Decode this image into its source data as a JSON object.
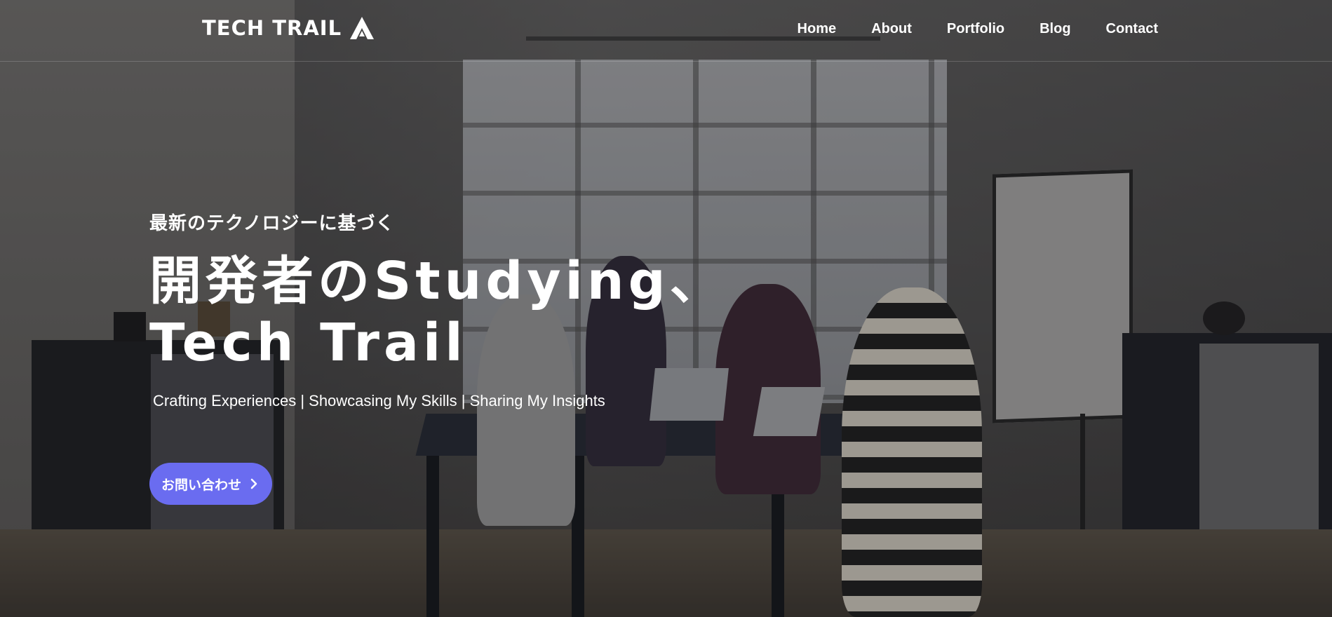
{
  "header": {
    "logo_text": "TECH TRAIL",
    "nav": [
      {
        "label": "Home"
      },
      {
        "label": "About"
      },
      {
        "label": "Portfolio"
      },
      {
        "label": "Blog"
      },
      {
        "label": "Contact"
      }
    ]
  },
  "hero": {
    "eyebrow": "最新のテクノロジーに基づく",
    "headline_line1": "開発者のStudying、",
    "headline_line2": "Tech Trail",
    "tagline": "Crafting Experiences | Showcasing My Skills | Sharing My Insights",
    "cta_label": "お問い合わせ",
    "cta_icon": "chevron-right-icon"
  },
  "colors": {
    "accent": "#6a6cf0",
    "text": "#ffffff"
  }
}
